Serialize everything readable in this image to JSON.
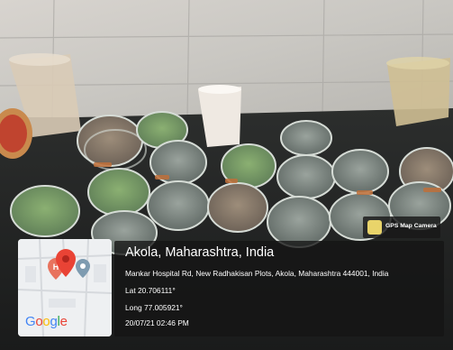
{
  "photo": {
    "subject": "lab-bench-with-petri-dishes"
  },
  "app_badge": {
    "label": "GPS Map Camera",
    "icon": "map-camera-icon"
  },
  "location_stamp": {
    "city": "Akola, Maharashtra, India",
    "address": "Mankar Hospital Rd, New Radhakisan Plots, Akola, Maharashtra 444001, India",
    "lat": "Lat 20.706111°",
    "long": "Long 77.005921°",
    "datetime": "20/07/21 02:46 PM"
  },
  "map_tile": {
    "logo": "Google",
    "pins": [
      "hospital-pin-icon",
      "location-pin-icon",
      "school-pin-icon"
    ]
  },
  "colors": {
    "pin_red": "#e94335",
    "google_blue": "#4285f4",
    "google_red": "#ea4335",
    "google_yellow": "#fbbc05",
    "google_green": "#34a853",
    "badge_icon": "#e9d46a"
  }
}
